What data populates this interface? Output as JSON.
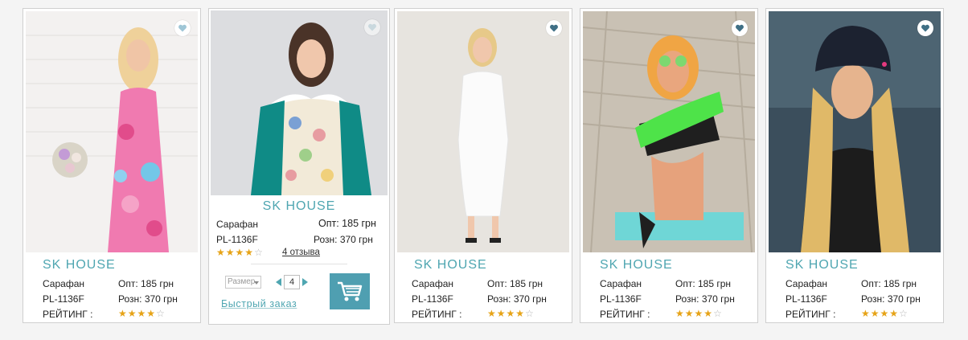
{
  "cards": [
    {
      "brand": "SK HOUSE",
      "name": "Сарафан",
      "sku": "PL-1136F",
      "opt_price": "Опт: 185 грн",
      "retail_price": "Розн: 370 грн",
      "rating_label": "РЕЙТИНГ :",
      "rating": 4,
      "favorite_icon": "heart-icon"
    },
    {
      "brand": "SK HOUSE",
      "name": "Сарафан",
      "sku": "PL-1136F",
      "opt_price": "Опт: 185 грн",
      "retail_price": "Розн: 370 грн",
      "rating": 4,
      "reviews": "4 отзыва",
      "size_placeholder": "Размер",
      "quantity": "4",
      "quick_order": "Быстрый заказ",
      "favorite_icon": "heart-icon",
      "cart_icon": "cart-icon"
    },
    {
      "brand": "SK HOUSE",
      "name": "Сарафан",
      "sku": "PL-1136F",
      "opt_price": "Опт: 185 грн",
      "retail_price": "Розн: 370 грн",
      "rating_label": "РЕЙТИНГ :",
      "rating": 4,
      "favorite_icon": "heart-icon"
    },
    {
      "brand": "SK HOUSE",
      "name": "Сарафан",
      "sku": "PL-1136F",
      "opt_price": "Опт: 185 грн",
      "retail_price": "Розн: 370 грн",
      "rating_label": "РЕЙТИНГ :",
      "rating": 4,
      "favorite_icon": "heart-icon"
    },
    {
      "brand": "SK HOUSE",
      "name": "Сарафан",
      "sku": "PL-1136F",
      "opt_price": "Опт: 185 грн",
      "retail_price": "Розн: 370 грн",
      "rating_label": "РЕЙТИНГ :",
      "rating": 4,
      "favorite_icon": "heart-icon"
    }
  ],
  "colors": {
    "accent": "#4fa6b1",
    "star": "#e6a317",
    "cart_button": "#4f9fb1"
  }
}
